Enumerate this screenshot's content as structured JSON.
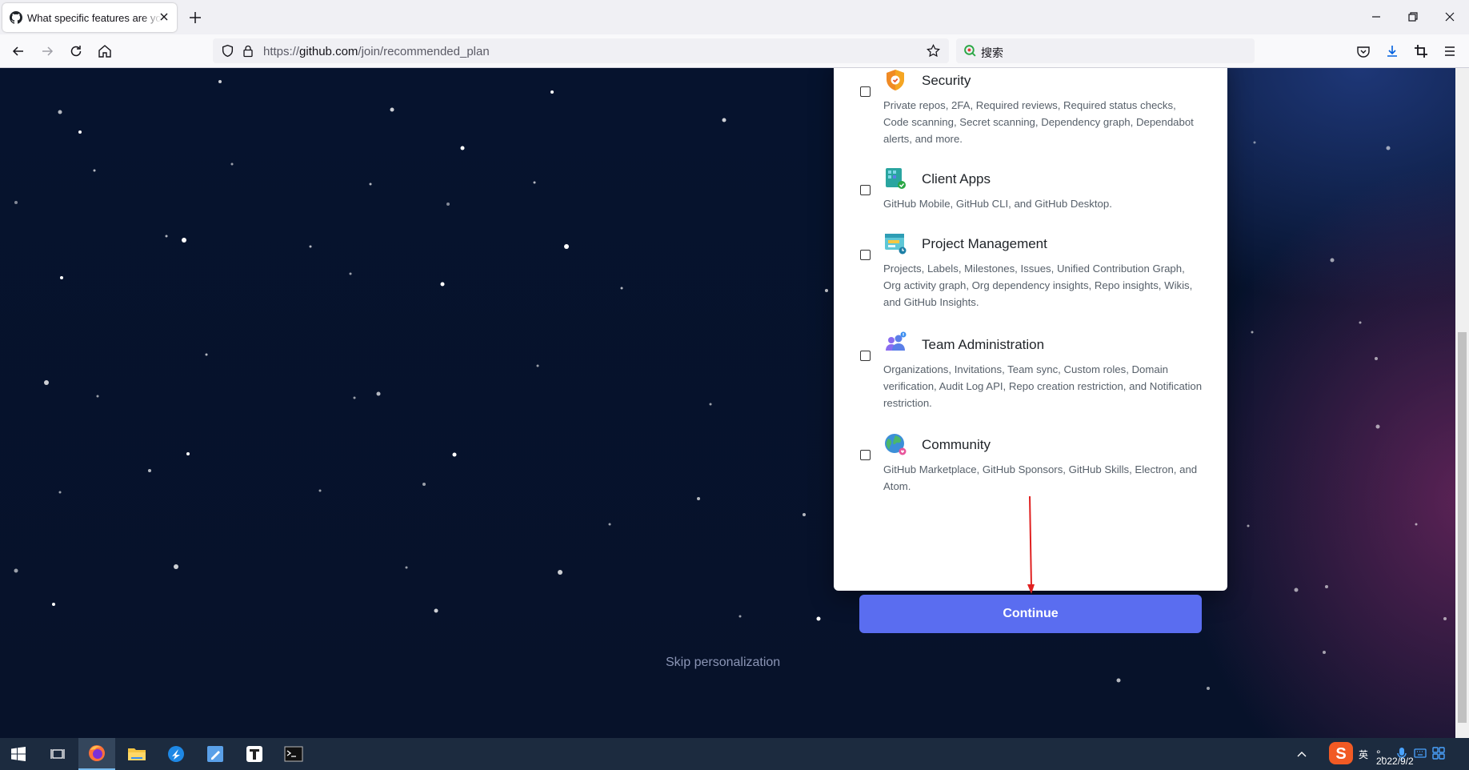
{
  "browser": {
    "tab_title": "What specific features are you",
    "url_prefix": "https://",
    "url_domain": "github.com",
    "url_path": "/join/recommended_plan",
    "search_placeholder": "搜索"
  },
  "features": [
    {
      "name": "Security",
      "icon": "shield-icon",
      "description": "Private repos, 2FA, Required reviews, Required status checks, Code scanning, Secret scanning, Dependency graph, Dependabot alerts, and more."
    },
    {
      "name": "Client Apps",
      "icon": "client-apps-icon",
      "description": "GitHub Mobile, GitHub CLI, and GitHub Desktop."
    },
    {
      "name": "Project Management",
      "icon": "project-board-icon",
      "description": "Projects, Labels, Milestones, Issues, Unified Contribution Graph, Org activity graph, Org dependency insights, Repo insights, Wikis, and GitHub Insights."
    },
    {
      "name": "Team Administration",
      "icon": "team-icon",
      "description": "Organizations, Invitations, Team sync, Custom roles, Domain verification, Audit Log API, Repo creation restriction, and Notification restriction."
    },
    {
      "name": "Community",
      "icon": "globe-icon",
      "description": "GitHub Marketplace, GitHub Sponsors, GitHub Skills, Electron, and Atom."
    }
  ],
  "continue_label": "Continue",
  "skip_label": "Skip personalization",
  "taskbar": {
    "ime_label": "英",
    "date": "2022/9/2"
  },
  "colors": {
    "continue_button": "#5a6df0",
    "page_background": "#07122a"
  }
}
